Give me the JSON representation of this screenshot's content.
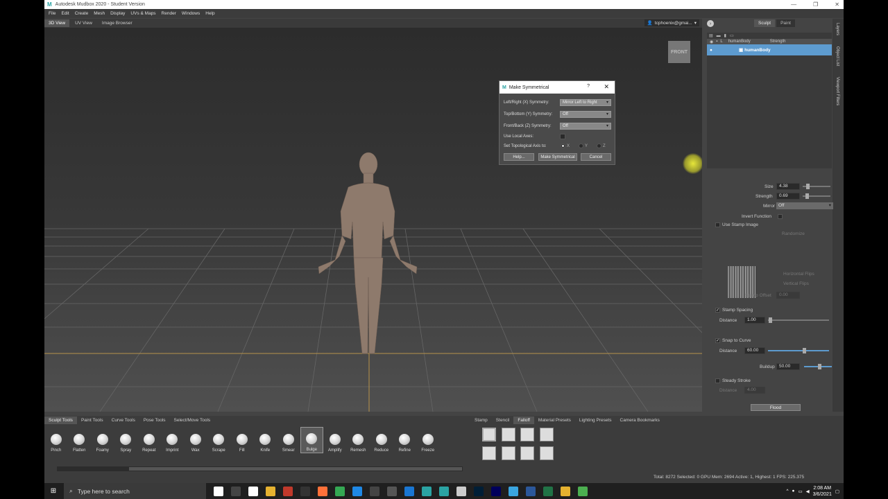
{
  "window": {
    "title": "Autodesk Mudbox 2020 - Student Version",
    "app_logo": "M"
  },
  "menu": [
    "File",
    "Edit",
    "Create",
    "Mesh",
    "Display",
    "UVs & Maps",
    "Render",
    "Windows",
    "Help"
  ],
  "view_tabs": [
    "3D View",
    "UV View",
    "Image Browser"
  ],
  "user": {
    "label": "tcphoenix@gmai..."
  },
  "viewport": {
    "cube_label": "FRONT"
  },
  "dialog": {
    "title": "Make Symmetrical",
    "help_glyph": "?",
    "close_glyph": "✕",
    "rows": [
      {
        "label": "Left/Right (X) Symmetry:",
        "value": "Mirror Left to Right"
      },
      {
        "label": "Top/Bottom (Y) Symmetry:",
        "value": "Off"
      },
      {
        "label": "Front/Back (Z) Symmetry:",
        "value": "Off"
      }
    ],
    "local_axes_label": "Use Local Axes:",
    "topo_label": "Set Topological Axis to:",
    "axes": [
      "X",
      "Y",
      "Z"
    ],
    "buttons": {
      "help": "Help...",
      "make": "Make Symmetrical",
      "cancel": "Cancel"
    }
  },
  "right_panel": {
    "tabs": [
      "Sculpt",
      "Paint"
    ],
    "side_tabs": [
      "Layers",
      "Object List",
      "Viewport Filters"
    ],
    "layers": {
      "col1": "L",
      "col2": "humanBody",
      "col3": "Strength",
      "selected": "humanBody"
    },
    "props": {
      "size_label": "Size",
      "size_value": "4.38",
      "strength_label": "Strength",
      "strength_value": "0.69",
      "mirror_label": "Mirror",
      "mirror_value": "Off",
      "invert_label": "Invert Function",
      "stamp_label": "Use Stamp Image",
      "randomize_label": "Randomize",
      "hflip_label": "Horizontal Flips",
      "vflip_label": "Vertical Flips",
      "stamp_offset_label": "Stamp Offset",
      "stamp_offset_value": "0.00",
      "stamp_spacing_label": "Stamp Spacing",
      "distance_label": "Distance",
      "spacing_distance": "1.00",
      "snap_label": "Snap to Curve",
      "snap_distance": "60.00",
      "buildup_label": "Buildup",
      "buildup_value": "50.00",
      "steady_label": "Steady Stroke",
      "steady_distance": "4.00",
      "flood_label": "Flood"
    }
  },
  "bottom": {
    "tabs": [
      "Sculpt Tools",
      "Paint Tools",
      "Curve Tools",
      "Pose Tools",
      "Select/Move Tools"
    ],
    "tools": [
      "Pinch",
      "Flatten",
      "Foamy",
      "Spray",
      "Repeat",
      "Imprint",
      "Wax",
      "Scrape",
      "Fill",
      "Knife",
      "Smear",
      "Bulge",
      "Amplify",
      "Remesh",
      "Reduce",
      "Refine",
      "Freeze"
    ],
    "active_tool": "Bulge",
    "right_tabs": [
      "Stamp",
      "Stencil",
      "Falloff",
      "Material Presets",
      "Lighting Presets",
      "Camera Bookmarks"
    ],
    "status": "Total: 8272  Selected: 0  GPU Mem: 2694  Active: 1, Highest: 1  FPS: 225.375"
  },
  "taskbar": {
    "search_placeholder": "Type here to search",
    "time": "2:08 AM",
    "date": "3/6/2021",
    "icon_colors": [
      "#ffffff",
      "#444444",
      "#ffffff",
      "#e6b230",
      "#c0392b",
      "#333333",
      "#ff7139",
      "#34a853",
      "#1e88e5",
      "#444444",
      "#555555",
      "#1976d2",
      "#2aa3a3",
      "#2aa3a3",
      "#cccccc",
      "#001e36",
      "#00005b",
      "#3aa5e0",
      "#2b579a",
      "#217346",
      "#e6b230",
      "#4caf50",
      "#1e88e5",
      "#1976d2",
      "#888888",
      "#1e88e5",
      "#2aa3a3",
      "#e53935",
      "#4caf50"
    ]
  }
}
